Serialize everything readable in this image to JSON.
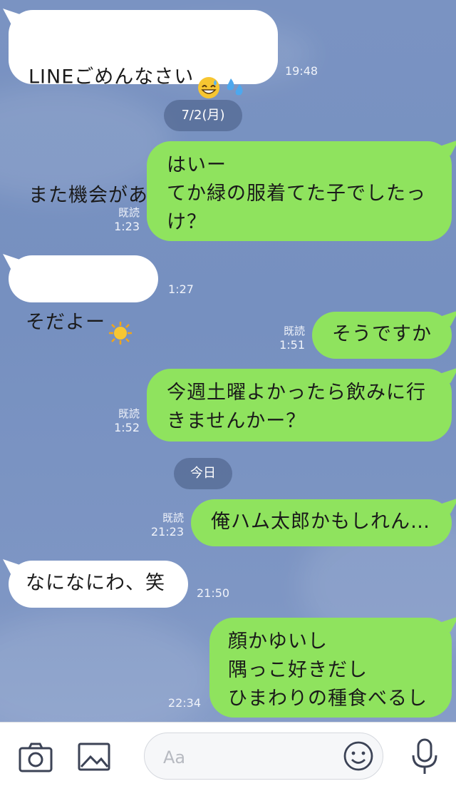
{
  "colors": {
    "background": "#7a93c2",
    "incoming_bubble": "#ffffff",
    "outgoing_bubble": "#8fe35e",
    "date_pill": "#5a6f9a"
  },
  "messages": [
    {
      "direction": "in",
      "text": "LINEごめんなさい\nまた機会があれば",
      "emojis": [
        "grinning-sweat-emoji",
        "sweat-droplets-emoji",
        "sun-emoji"
      ],
      "time": "19:48"
    },
    {
      "direction": "out",
      "text": "はいー\nてか緑の服着てた子でしたっ\nけ？",
      "read": "既読",
      "time": "1:23"
    },
    {
      "direction": "in",
      "text": "そだよー",
      "emojis": [
        "sun-emoji"
      ],
      "time": "1:27"
    },
    {
      "direction": "out",
      "text": "そうですか",
      "read": "既読",
      "time": "1:51"
    },
    {
      "direction": "out",
      "text": "今週土曜よかったら飲みに行\nきませんかー？",
      "read": "既読",
      "time": "1:52"
    },
    {
      "direction": "out",
      "text": "俺ハム太郎かもしれん…",
      "read": "既読",
      "time": "21:23"
    },
    {
      "direction": "in",
      "text": "なになにわ、笑",
      "time": "21:50"
    },
    {
      "direction": "out",
      "text": "顔かゆいし\n隅っこ好きだし\nひまわりの種食べるし",
      "time": "22:34"
    }
  ],
  "date_separators": [
    "7/2(月)",
    "今日"
  ],
  "input_bar": {
    "placeholder": "Aa",
    "icons": [
      "camera-icon",
      "image-icon",
      "emoji-icon",
      "microphone-icon"
    ]
  }
}
